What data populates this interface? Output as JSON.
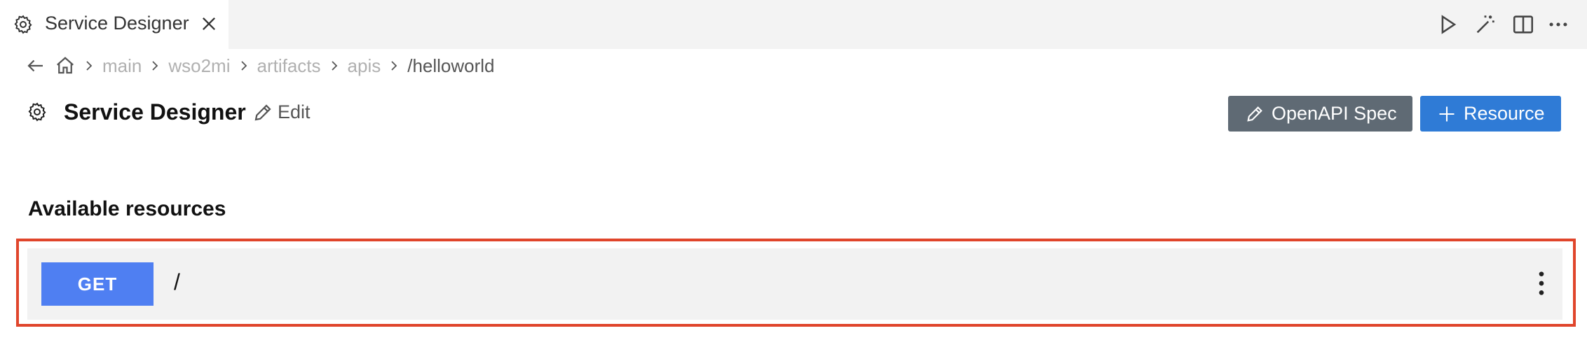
{
  "tab": {
    "title": "Service Designer",
    "icon": "gear-icon",
    "close_icon": "close-icon"
  },
  "editor_actions": [
    {
      "name": "run-icon"
    },
    {
      "name": "magic-wand-icon"
    },
    {
      "name": "split-editor-icon"
    },
    {
      "name": "more-actions-icon"
    }
  ],
  "breadcrumb": {
    "back_icon": "arrow-left-icon",
    "home_icon": "home-icon",
    "items": [
      "main",
      "wso2mi",
      "artifacts",
      "apis",
      "/helloworld"
    ]
  },
  "header": {
    "title": "Service Designer",
    "edit_label": "Edit"
  },
  "buttons": {
    "openapi_label": "OpenAPI Spec",
    "resource_label": "Resource"
  },
  "resources": {
    "section_title": "Available resources",
    "items": [
      {
        "method": "GET",
        "path": "/"
      }
    ]
  },
  "colors": {
    "method_get": "#4f7ff2",
    "primary_button": "#2f7bd6",
    "secondary_button": "#5f6a74",
    "highlight": "#e0452b"
  }
}
